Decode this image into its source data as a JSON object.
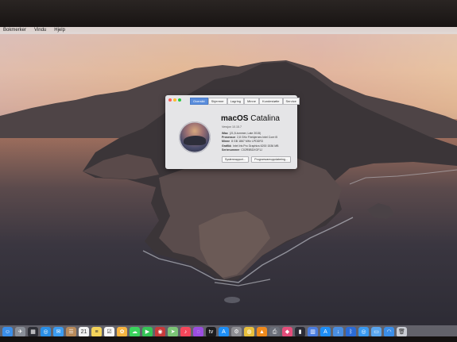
{
  "menubar": {
    "items": [
      "Bokmerker",
      "Vindu",
      "Hjelp"
    ]
  },
  "about_window": {
    "traffic_lights": [
      "#ff5f57",
      "#febc2e",
      "#28c840"
    ],
    "tabs": [
      {
        "label": "Oversikt",
        "active": true
      },
      {
        "label": "Skjermer",
        "active": false
      },
      {
        "label": "Lagring",
        "active": false
      },
      {
        "label": "Minne",
        "active": false
      },
      {
        "label": "Kundestøtte",
        "active": false
      },
      {
        "label": "Service",
        "active": false
      }
    ],
    "os_name_bold": "macOS",
    "os_name_light": "Catalina",
    "version": "Versjon 10.15.7",
    "specs": [
      {
        "key": "iMac",
        "value": "(21,5-tommer, Late 2015)"
      },
      {
        "key": "Prosessor",
        "value": "2,8 GHz Firekjernes Intel Core i5"
      },
      {
        "key": "Minne",
        "value": "8 GB 1867 MHz LPDDR3"
      },
      {
        "key": "Grafikk",
        "value": "Intel Iris Pro Graphics 6200 1536 MB"
      },
      {
        "key": "Serienummer",
        "value": "C02R5BDXGF1J"
      }
    ],
    "buttons": [
      "Systemrapport…",
      "Programvareoppdatering…"
    ]
  },
  "dock": {
    "icons": [
      {
        "name": "finder-icon",
        "color": "#3b8ee8",
        "glyph": "☺"
      },
      {
        "name": "launchpad-icon",
        "color": "#8a8f98",
        "glyph": "✈"
      },
      {
        "name": "mission-control-icon",
        "color": "#2e2f36",
        "glyph": "▦"
      },
      {
        "name": "safari-icon",
        "color": "#2a8fe6",
        "glyph": "◎"
      },
      {
        "name": "mail-icon",
        "color": "#3c9cf0",
        "glyph": "✉"
      },
      {
        "name": "contacts-icon",
        "color": "#b88a5a",
        "glyph": "☰"
      },
      {
        "name": "calendar-icon",
        "color": "#f2f2f2",
        "glyph": "21"
      },
      {
        "name": "notes-icon",
        "color": "#f4d35a",
        "glyph": "≡"
      },
      {
        "name": "reminders-icon",
        "color": "#f7f7f7",
        "glyph": "☑"
      },
      {
        "name": "photos-icon",
        "color": "#f6b440",
        "glyph": "✿"
      },
      {
        "name": "messages-icon",
        "color": "#3bd35d",
        "glyph": "☁"
      },
      {
        "name": "facetime-icon",
        "color": "#35c456",
        "glyph": "▶"
      },
      {
        "name": "photo-booth-icon",
        "color": "#c73b3b",
        "glyph": "◉"
      },
      {
        "name": "maps-icon",
        "color": "#7cc576",
        "glyph": "➤"
      },
      {
        "name": "music-icon",
        "color": "#f5475b",
        "glyph": "♪"
      },
      {
        "name": "podcasts-icon",
        "color": "#9b4de0",
        "glyph": "◌"
      },
      {
        "name": "tv-icon",
        "color": "#1c1c1e",
        "glyph": "tv"
      },
      {
        "name": "app-store-icon",
        "color": "#1e8ef5",
        "glyph": "A"
      },
      {
        "name": "system-preferences-icon",
        "color": "#8e8e93",
        "glyph": "⚙"
      },
      {
        "name": "chrome-icon",
        "color": "#e9c03c",
        "glyph": "◍"
      },
      {
        "name": "vlc-icon",
        "color": "#f08a1c",
        "glyph": "▲"
      },
      {
        "name": "printer-icon",
        "color": "#6b6f79",
        "glyph": "⎙"
      },
      {
        "name": "app-icon",
        "color": "#e44d7a",
        "glyph": "◆"
      },
      {
        "name": "audio-icon",
        "color": "#2b2b35",
        "glyph": "▮"
      },
      {
        "name": "equalizer-icon",
        "color": "#4b7de0",
        "glyph": "▥"
      },
      {
        "name": "app-store-2-icon",
        "color": "#1e8ef5",
        "glyph": "A"
      },
      {
        "name": "downloads-icon",
        "color": "#4a8ee0",
        "glyph": "↓"
      },
      {
        "name": "bluetooth-icon",
        "color": "#2b6bd6",
        "glyph": "ᛒ"
      },
      {
        "name": "airdrop-icon",
        "color": "#3a9af0",
        "glyph": "◎"
      },
      {
        "name": "folder-icon",
        "color": "#5aa6ee",
        "glyph": "▭"
      },
      {
        "name": "wifi-icon",
        "color": "#3b8ee8",
        "glyph": "◠"
      },
      {
        "name": "trash-icon",
        "color": "#c9ccd3",
        "glyph": "🗑"
      }
    ]
  }
}
